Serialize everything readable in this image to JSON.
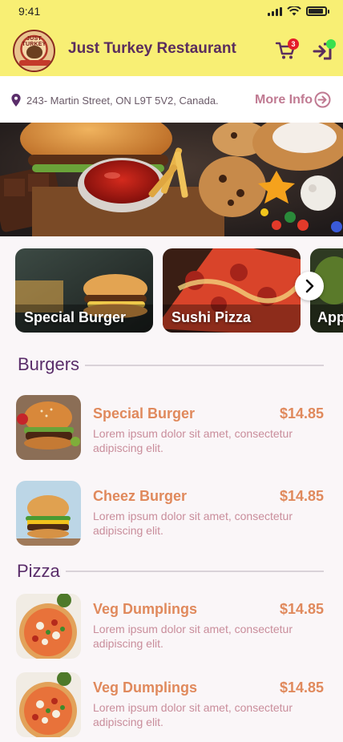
{
  "status": {
    "time": "9:41"
  },
  "header": {
    "restaurant_name": "Just Turkey Restaurant",
    "logo_text": "JUST TURKEY",
    "cart_count": "3"
  },
  "address": {
    "text": "243- Martin Street, ON L9T 5V2, Canada.",
    "more_info_label": "More Info"
  },
  "categories": [
    {
      "label": "Special Burger"
    },
    {
      "label": "Sushi Pizza"
    },
    {
      "label": "App"
    }
  ],
  "sections": [
    {
      "title": "Burgers",
      "items": [
        {
          "name": "Special Burger",
          "price": "$14.85",
          "desc": "Lorem ipsum dolor sit amet, consectetur adipiscing elit."
        },
        {
          "name": "Cheez Burger",
          "price": "$14.85",
          "desc": "Lorem ipsum dolor sit amet, consectetur adipiscing elit."
        }
      ]
    },
    {
      "title": "Pizza",
      "items": [
        {
          "name": "Veg Dumplings",
          "price": "$14.85",
          "desc": "Lorem ipsum dolor sit amet, consectetur adipiscing elit."
        },
        {
          "name": "Veg Dumplings",
          "price": "$14.85",
          "desc": "Lorem ipsum dolor sit amet, consectetur adipiscing elit."
        }
      ]
    }
  ],
  "icons": {
    "cart": "cart-icon",
    "logout": "logout-icon",
    "pin": "location-pin-icon",
    "more_info": "arrow-circle-right-icon",
    "next": "chevron-right-icon"
  },
  "colors": {
    "header_bg": "#f8ef74",
    "brand_purple": "#5a2d5e",
    "price_orange": "#e0895c",
    "badge_red": "#e41d2a",
    "online_green": "#39e04d"
  }
}
